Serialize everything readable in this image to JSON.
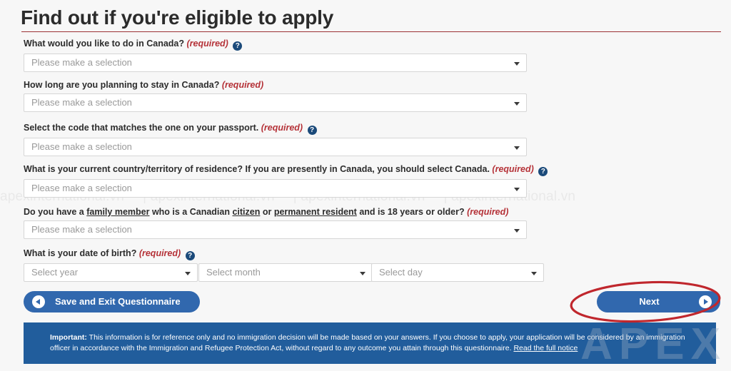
{
  "page": {
    "title": "Find out if you're eligible to apply",
    "watermark_text": "apexinternational.vn",
    "watermark_logo": "APEX",
    "accent_rule_color": "#9c3236",
    "button_color": "#3168ae",
    "notice_bg_color": "#215d9c",
    "annotation_color": "#c0272d",
    "required_label_color": "#b53238"
  },
  "form": {
    "placeholder": "Please make a selection",
    "required_tag": "(required)",
    "help_icon": "question-mark-circle-icon",
    "fields": [
      {
        "id": "purpose",
        "label": "What would you like to do in Canada?",
        "required": "(required)",
        "has_help": true,
        "value": "Please make a selection"
      },
      {
        "id": "duration",
        "label": "How long are you planning to stay in Canada?",
        "required": "(required)",
        "has_help": false,
        "value": "Please make a selection"
      },
      {
        "id": "passport-code",
        "label": "Select the code that matches the one on your passport.",
        "required": "(required)",
        "has_help": true,
        "value": "Please make a selection"
      },
      {
        "id": "residence",
        "label": "What is your current country/territory of residence? If you are presently in Canada, you should select Canada.",
        "required": "(required)",
        "has_help": true,
        "value": "Please make a selection"
      },
      {
        "id": "family-member",
        "label_parts": {
          "p1": "Do you have a ",
          "link1": "family member",
          "p2": " who is a Canadian ",
          "link2": "citizen",
          "p3": " or ",
          "link3": "permanent resident",
          "p4": " and is 18 years or older?"
        },
        "required": "(required)",
        "has_help": false,
        "value": "Please make a selection"
      }
    ],
    "date_of_birth": {
      "label": "What is your date of birth?",
      "required": "(required)",
      "has_help": true,
      "year": "Select year",
      "month": "Select month",
      "day": "Select day"
    }
  },
  "buttons": {
    "save": {
      "label": "Save and Exit Questionnaire",
      "icon": "arrow-left-circle-icon"
    },
    "next": {
      "label": "Next",
      "icon": "arrow-right-circle-icon"
    }
  },
  "notice": {
    "prefix": "Important:",
    "body": " This information is for reference only and no immigration decision will be made based on your answers. If you choose to apply, your application will be considered by an immigration officer in accordance with the Immigration and Refugee Protection Act, without regard to any outcome you attain through this questionnaire. ",
    "link": "Read the full notice"
  }
}
